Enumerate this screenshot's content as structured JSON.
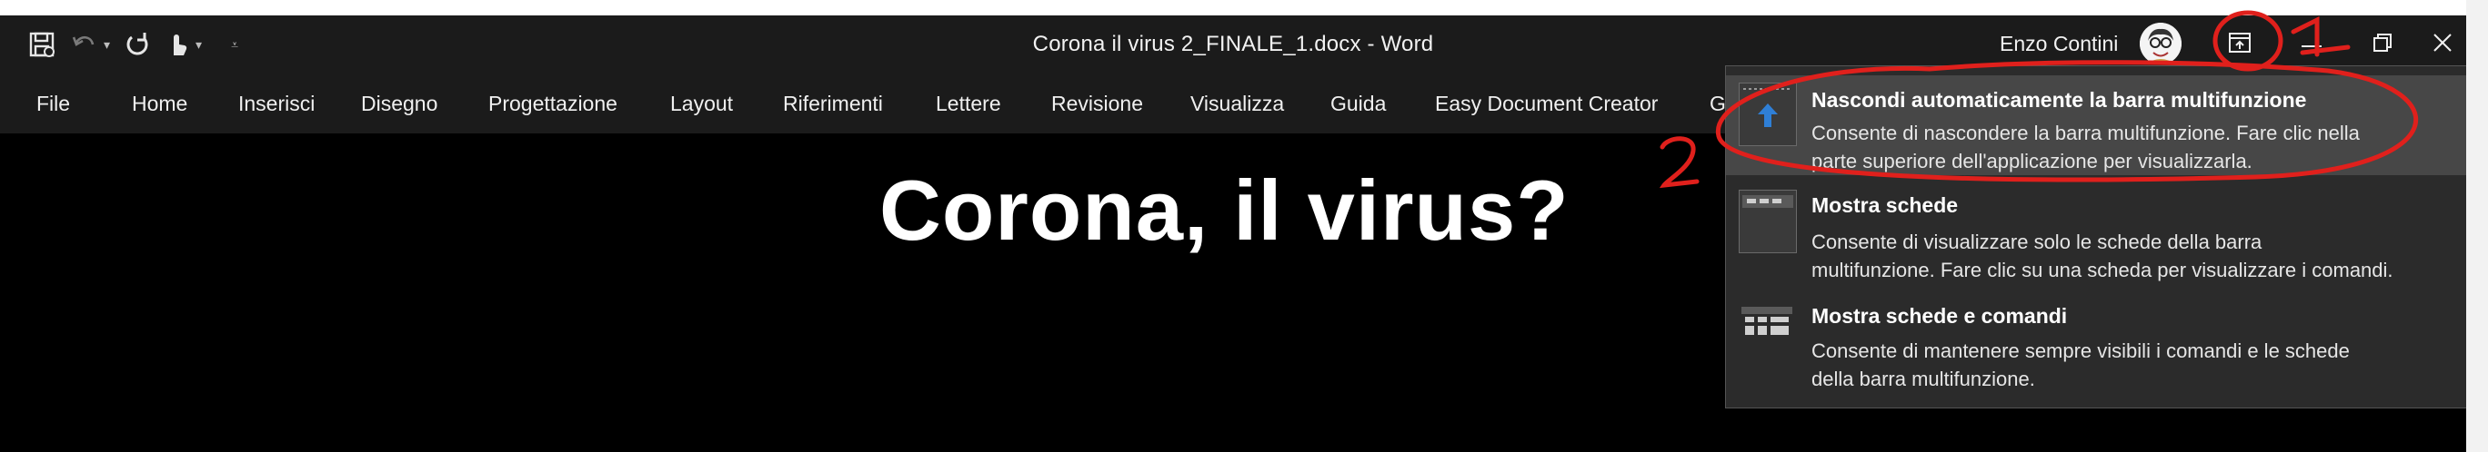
{
  "window": {
    "document_title": "Corona il virus 2_FINALE_1.docx  -  Word",
    "user_name": "Enzo Contini"
  },
  "ribbon_tabs": [
    "File",
    "Home",
    "Inserisci",
    "Disegno",
    "Progettazione",
    "Layout",
    "Riferimenti",
    "Lettere",
    "Revisione",
    "Visualizza",
    "Guida",
    "Easy Document Creator",
    "G"
  ],
  "document": {
    "heading": "Corona, il virus?"
  },
  "ribbon_display_menu": {
    "items": [
      {
        "title": "Nascondi automaticamente la barra multifunzione",
        "description_line1": "Consente di nascondere la barra multifunzione. Fare clic nella",
        "description_line2": "parte superiore dell'applicazione per visualizzarla."
      },
      {
        "title": "Mostra schede",
        "description_line1": "Consente di visualizzare solo le schede della barra",
        "description_line2": "multifunzione. Fare clic su una scheda per visualizzare i comandi."
      },
      {
        "title": "Mostra schede e comandi",
        "description_line1": "Consente di mantenere sempre visibili i comandi e le schede",
        "description_line2": "della barra multifunzione."
      }
    ]
  },
  "annotations": {
    "label_1": "1",
    "label_2": "2"
  },
  "colors": {
    "titlebar": "#1b1b1b",
    "document_bg": "#000000",
    "menu_bg": "#2b2b2b",
    "menu_highlight": "#474747",
    "annotation_red": "#e0201c",
    "icon_blue": "#2f7fd6"
  }
}
